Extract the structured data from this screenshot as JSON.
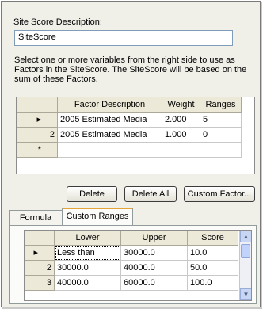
{
  "site_score": {
    "description_label": "Site Score Description:",
    "description_value": "SiteScore",
    "instructions": "Select one or more variables from the right side to use as Factors in the SiteScore.  The SiteScore will be based on the sum of these Factors."
  },
  "factors_grid": {
    "columns": [
      "Factor Description",
      "Weight",
      "Ranges"
    ],
    "rows": [
      {
        "row_header": "▸",
        "factor": "2005 Estimated Media",
        "weight": "2.000",
        "ranges": "5"
      },
      {
        "row_header": "2",
        "factor": "2005 Estimated Media",
        "weight": "1.000",
        "ranges": "0"
      },
      {
        "row_header": "*",
        "factor": "",
        "weight": "",
        "ranges": ""
      }
    ]
  },
  "buttons": {
    "delete": "Delete",
    "delete_all": "Delete All",
    "custom_factor": "Custom Factor..."
  },
  "tabs": {
    "formula": "Formula",
    "custom_ranges": "Custom Ranges",
    "active": "custom_ranges"
  },
  "ranges_grid": {
    "columns": [
      "Lower",
      "Upper",
      "Score"
    ],
    "rows": [
      {
        "row_header": "▸",
        "lower": "Less than",
        "upper": "30000.0",
        "score": "10.0"
      },
      {
        "row_header": "2",
        "lower": "30000.0",
        "upper": "40000.0",
        "score": "50.0"
      },
      {
        "row_header": "3",
        "lower": "40000.0",
        "upper": "60000.0",
        "score": "100.0"
      }
    ]
  },
  "colors": {
    "panel_bg": "#f0efe8",
    "grid_header_bg": "#ece9d8",
    "tab_highlight": "#e5a33a",
    "scrollbar": "#c8d6f3"
  }
}
